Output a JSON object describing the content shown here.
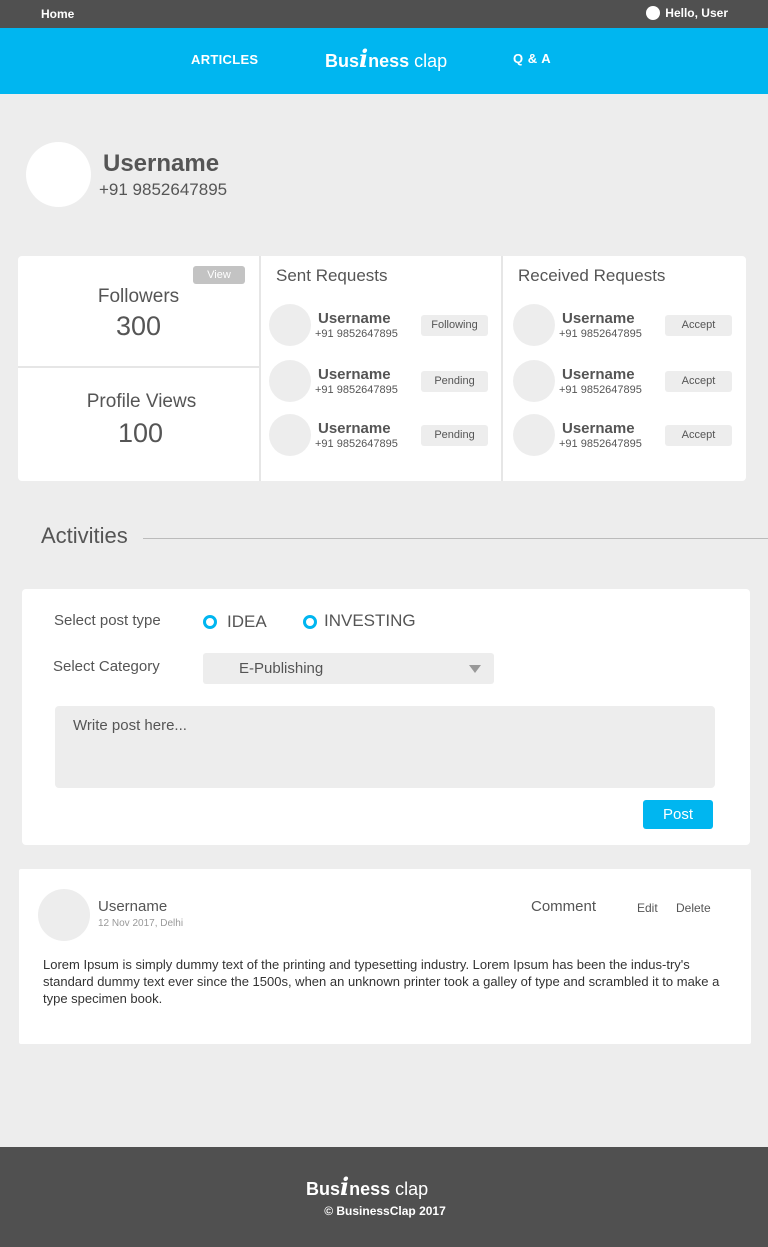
{
  "topbar": {
    "home": "Home",
    "greeting": "Hello, User"
  },
  "nav": {
    "articles": "ARTICLES",
    "logo": {
      "part1": "Bus",
      "part2": "i",
      "part3": "ness",
      "part4": " clap"
    },
    "qa": "Q & A"
  },
  "profile": {
    "name": "Username",
    "phone": "+91 9852647895"
  },
  "stats": {
    "view_label": "View",
    "followers_label": "Followers",
    "followers_value": "300",
    "views_label": "Profile Views",
    "views_value": "100"
  },
  "sent_requests": {
    "title": "Sent Requests",
    "items": [
      {
        "name": "Username",
        "phone": "+91 9852647895",
        "status": "Following"
      },
      {
        "name": "Username",
        "phone": "+91 9852647895",
        "status": "Pending"
      },
      {
        "name": "Username",
        "phone": "+91 9852647895",
        "status": "Pending"
      }
    ]
  },
  "received_requests": {
    "title": "Received Requests",
    "items": [
      {
        "name": "Username",
        "phone": "+91 9852647895",
        "action": "Accept"
      },
      {
        "name": "Username",
        "phone": "+91 9852647895",
        "action": "Accept"
      },
      {
        "name": "Username",
        "phone": "+91 9852647895",
        "action": "Accept"
      }
    ]
  },
  "activities": {
    "title": "Activities",
    "post_type_label": "Select post type",
    "options": [
      "IDEA",
      "INVESTING"
    ],
    "category_label": "Select Category",
    "category_value": "E-Publishing",
    "post_placeholder": "Write post here...",
    "post_button": "Post"
  },
  "feed": {
    "name": "Username",
    "meta": "12 Nov 2017, Delhi",
    "comment": "Comment",
    "edit": "Edit",
    "delete": "Delete",
    "body": "Lorem Ipsum is simply dummy text of the printing and typesetting industry. Lorem Ipsum has been the indus-try's standard dummy text ever since the 1500s, when an unknown printer took a galley of type and scrambled it to make a type specimen book."
  },
  "footer": {
    "logo": {
      "part1": "Bus",
      "part2": "i",
      "part3": "ness",
      "part4": " clap"
    },
    "copyright": "© BusinessClap 2017"
  },
  "colors": {
    "accent": "#00b6f0",
    "dark": "#505050",
    "background": "#ededed"
  }
}
